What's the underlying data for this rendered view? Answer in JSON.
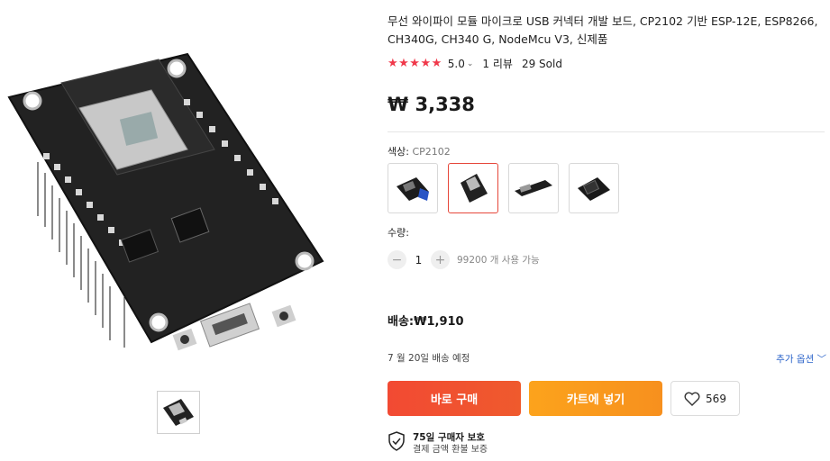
{
  "gallery": {
    "main_image_icon": "esp8266-nodemcu-board-image",
    "thumbnail_icon": "esp8266-board-thumbnail"
  },
  "product": {
    "title": "무선 와이파이 모듈 마이크로 USB 커넥터 개발 보드, CP2102 기반 ESP-12E, ESP8266, CH340G, CH340 G, NodeMcu V3, 신제품",
    "stars": "★★★★★",
    "rating": "5.0",
    "reviews": "1 리뷰",
    "sold": "29 Sold",
    "price": "₩ 3,338"
  },
  "color": {
    "label": "색상: ",
    "selected": "CP2102",
    "variant_icons": [
      "board-blue-dock-icon",
      "board-cp2102-icon",
      "board-long-icon",
      "board-black-dock-icon"
    ]
  },
  "quantity": {
    "label": "수량:",
    "minus": "−",
    "value": "1",
    "plus": "+",
    "available": "99200 개 사용 가능"
  },
  "shipping": {
    "text": "배송:₩1,910",
    "delivery": "7 월 20일 배송 예정",
    "more_options": "추가 옵션"
  },
  "actions": {
    "buy_now": "바로 구매",
    "add_to_cart": "카트에 넣기",
    "wishlist_count": "569"
  },
  "protection": {
    "title": "75일 구매자 보호",
    "subtitle": "결제 금액 환불 보증"
  },
  "colors": {
    "star": "#f0384a",
    "buy": "#f24a33",
    "cart": "#fca31c",
    "link": "#2a62c9",
    "selected_border": "#e6473a"
  }
}
